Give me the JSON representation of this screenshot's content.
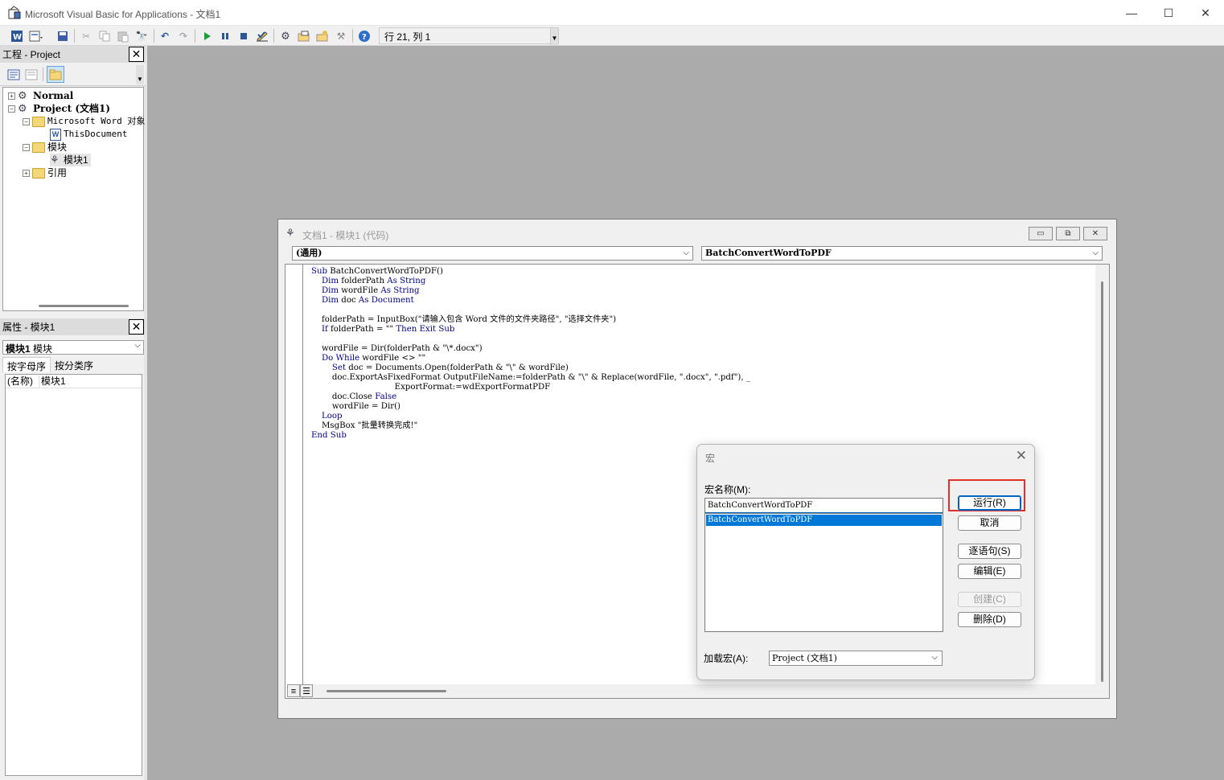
{
  "window": {
    "title": "Microsoft Visual Basic for Applications - 文档1",
    "minimize": "—",
    "maximize": "☐",
    "close": "✕"
  },
  "toolbar": {
    "position_text": "行 21, 列 1",
    "icons": [
      "word-icon",
      "insert-userform-icon",
      "save-icon",
      "cut-icon",
      "copy-icon",
      "paste-icon",
      "find-icon",
      "undo-icon",
      "redo-icon",
      "run-icon",
      "break-icon",
      "reset-icon",
      "design-mode-icon",
      "project-explorer-icon",
      "properties-icon",
      "object-browser-icon",
      "toolbox-icon",
      "help-icon"
    ]
  },
  "project_pane": {
    "title": "工程 - Project",
    "tree": [
      {
        "label": "Normal",
        "level": 0,
        "expander": "+"
      },
      {
        "label": "Project (文档1)",
        "level": 0,
        "expander": "−"
      },
      {
        "label": "Microsoft Word 对象",
        "level": 1,
        "expander": "−"
      },
      {
        "label": "ThisDocument",
        "level": 2,
        "expander": ""
      },
      {
        "label": "模块",
        "level": 1,
        "expander": "−"
      },
      {
        "label": "模块1",
        "level": 2,
        "expander": ""
      },
      {
        "label": "引用",
        "level": 1,
        "expander": "+"
      }
    ]
  },
  "properties_pane": {
    "title": "属性 - 模块1",
    "object_combo_bold": "模块1",
    "object_combo_type": " 模块",
    "tabs": [
      "按字母序",
      "按分类序"
    ],
    "rows": [
      {
        "name": "(名称)",
        "value": "模块1"
      }
    ]
  },
  "code_window": {
    "title": "文档1 - 模块1 (代码)",
    "object_combo": "(通用)",
    "procedure_combo": "BatchConvertWordToPDF",
    "code_lines": [
      "Sub BatchConvertWordToPDF()",
      "    Dim folderPath As String",
      "    Dim wordFile As String",
      "    Dim doc As Document",
      "",
      "    folderPath = InputBox(\"请输入包含 Word 文件的文件夹路径\", \"选择文件夹\")",
      "    If folderPath = \"\" Then Exit Sub",
      "",
      "    wordFile = Dir(folderPath & \"\\*.docx\")",
      "    Do While wordFile <> \"\"",
      "        Set doc = Documents.Open(folderPath & \"\\\" & wordFile)",
      "        doc.ExportAsFixedFormat OutputFileName:=folderPath & \"\\\" & Replace(wordFile, \".docx\", \".pdf\"), _",
      "                                ExportFormat:=wdExportFormatPDF",
      "        doc.Close False",
      "        wordFile = Dir()",
      "    Loop",
      "    MsgBox \"批量转换完成!\"",
      "End Sub"
    ]
  },
  "macro_dialog": {
    "title": "宏",
    "name_label": "宏名称(M):",
    "name_value": "BatchConvertWordToPDF",
    "list_items": [
      "BatchConvertWordToPDF"
    ],
    "buttons": {
      "run": "运行(R)",
      "cancel": "取消",
      "step": "逐语句(S)",
      "edit": "编辑(E)",
      "create": "创建(C)",
      "delete": "删除(D)"
    },
    "load_label": "加载宏(A):",
    "load_value": "Project (文档1)",
    "highlight_color": "#e0302b"
  },
  "colors": {
    "keyword": "#00008b",
    "selection": "#0078d7",
    "mdi_background": "#ababab"
  }
}
